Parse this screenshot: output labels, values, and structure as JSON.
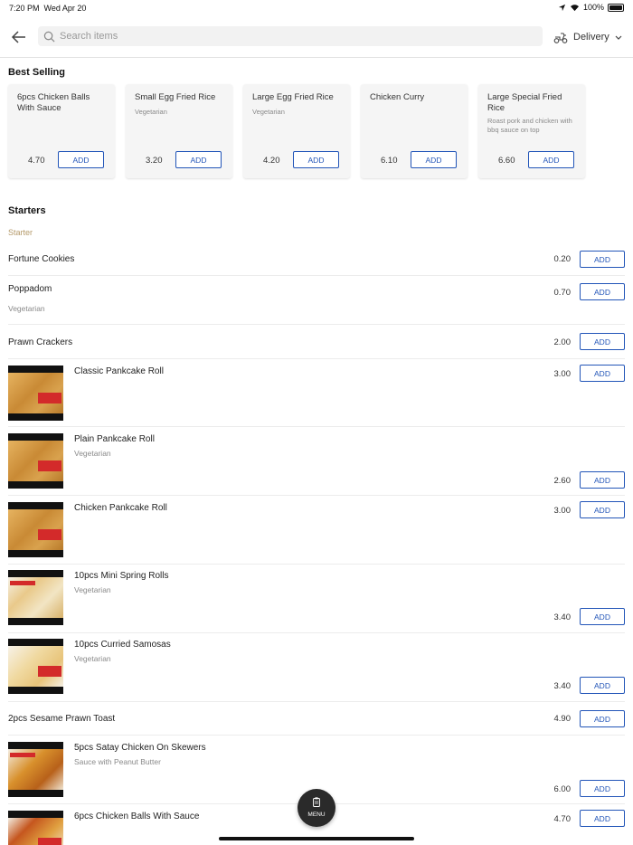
{
  "status_bar": {
    "time": "7:20 PM",
    "date": "Wed Apr 20",
    "battery": "100%"
  },
  "search": {
    "placeholder": "Search items"
  },
  "delivery": {
    "label": "Delivery"
  },
  "best_selling": {
    "title": "Best Selling",
    "items": [
      {
        "name": "6pcs Chicken Balls With Sauce",
        "sub": "",
        "price": "4.70",
        "add": "ADD"
      },
      {
        "name": "Small Egg Fried Rice",
        "sub": "Vegetarian",
        "price": "3.20",
        "add": "ADD"
      },
      {
        "name": "Large Egg Fried Rice",
        "sub": "Vegetarian",
        "price": "4.20",
        "add": "ADD"
      },
      {
        "name": "Chicken Curry",
        "sub": "",
        "price": "6.10",
        "add": "ADD"
      },
      {
        "name": "Large Special Fried Rice",
        "sub": "Roast pork and chicken with bbq sauce on top",
        "price": "6.60",
        "add": "ADD"
      }
    ]
  },
  "starters": {
    "title": "Starters",
    "category": "Starter",
    "items": [
      {
        "name": "Fortune Cookies",
        "sub": "",
        "price": "0.20",
        "add": "ADD"
      },
      {
        "name": "Poppadom",
        "sub": "Vegetarian",
        "price": "0.70",
        "add": "ADD"
      },
      {
        "name": "Prawn Crackers",
        "sub": "",
        "price": "2.00",
        "add": "ADD"
      },
      {
        "name": "Classic Pankcake Roll",
        "sub": "",
        "price": "3.00",
        "add": "ADD"
      },
      {
        "name": "Plain Pankcake Roll",
        "sub": "Vegetarian",
        "price": "2.60",
        "add": "ADD"
      },
      {
        "name": "Chicken Pankcake Roll",
        "sub": "",
        "price": "3.00",
        "add": "ADD"
      },
      {
        "name": "10pcs Mini Spring Rolls",
        "sub": "Vegetarian",
        "price": "3.40",
        "add": "ADD"
      },
      {
        "name": "10pcs Curried Samosas",
        "sub": "Vegetarian",
        "price": "3.40",
        "add": "ADD"
      },
      {
        "name": "2pcs Sesame Prawn Toast",
        "sub": "",
        "price": "4.90",
        "add": "ADD"
      },
      {
        "name": "5pcs Satay Chicken On Skewers",
        "sub": "Sauce with Peanut Butter",
        "price": "6.00",
        "add": "ADD"
      },
      {
        "name": "6pcs Chicken Balls With Sauce",
        "sub": "",
        "price": "4.70",
        "add": "ADD"
      }
    ]
  },
  "menu_button": {
    "label": "MENU"
  },
  "colors": {
    "accent": "#2255b8",
    "category": "#b59a6a"
  }
}
